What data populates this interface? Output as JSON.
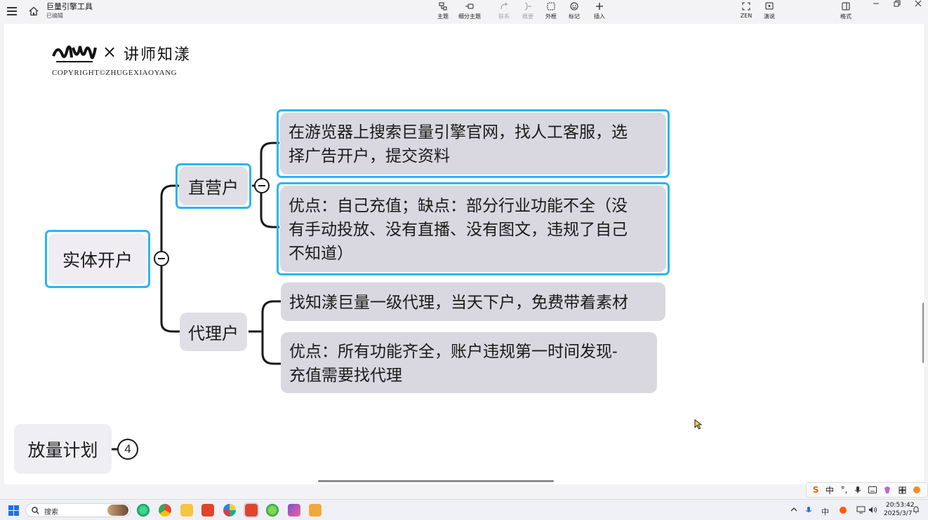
{
  "app": {
    "doc_title": "巨量引擎工具",
    "doc_status": "已编辑"
  },
  "toolbar": [
    {
      "label": "主题",
      "icon": "topic-icon",
      "enabled": true
    },
    {
      "label": "细分主题",
      "icon": "subtopic-icon",
      "enabled": true
    },
    {
      "label": "联系",
      "icon": "relation-icon",
      "enabled": false
    },
    {
      "label": "概要",
      "icon": "summary-icon",
      "enabled": false
    },
    {
      "label": "外框",
      "icon": "boundary-icon",
      "enabled": true
    },
    {
      "label": "标记",
      "icon": "marker-icon",
      "enabled": true
    },
    {
      "label": "插入",
      "icon": "insert-icon",
      "enabled": true
    },
    {
      "label": "ZEN",
      "icon": "zen-icon",
      "enabled": true
    },
    {
      "label": "演说",
      "icon": "pitch-icon",
      "enabled": true
    },
    {
      "label": "格式",
      "icon": "format-panel-icon",
      "enabled": true
    }
  ],
  "brand": {
    "x_mark": "×",
    "name": "讲师知漾",
    "copyright": "COPYRIGHT©ZHUGEXIAOYANG"
  },
  "mindmap": {
    "root": "实体开户",
    "branches": [
      {
        "label": "直营户",
        "leaves": [
          [
            "在游览器上搜索巨量引擎官网，找人工客服，选",
            "择广告开户，提交资料"
          ],
          [
            "优点：自己充值；缺点：部分行业功能不全（没",
            "有手动投放、没有直播、没有图文，违规了自己",
            "不知道）"
          ]
        ]
      },
      {
        "label": "代理户",
        "leaves": [
          [
            "找知漾巨量一级代理，当天下户，免费带着素材"
          ],
          [
            "优点：所有功能齐全，账户违规第一时间发现-",
            "充值需要找代理"
          ]
        ]
      }
    ],
    "collapsed_topic": "放量计划",
    "collapsed_count": "4"
  },
  "ime": {
    "logo": "S",
    "mode": "中",
    "punct": "°,"
  },
  "taskbar": {
    "search_placeholder": "搜索",
    "ime_indicator": "中",
    "time": "20:53:42",
    "date": "2025/3/7"
  },
  "colors": {
    "selection": "#29b6ef",
    "node_fill": "#e0dfe6",
    "connector": "#1a1a1a"
  }
}
